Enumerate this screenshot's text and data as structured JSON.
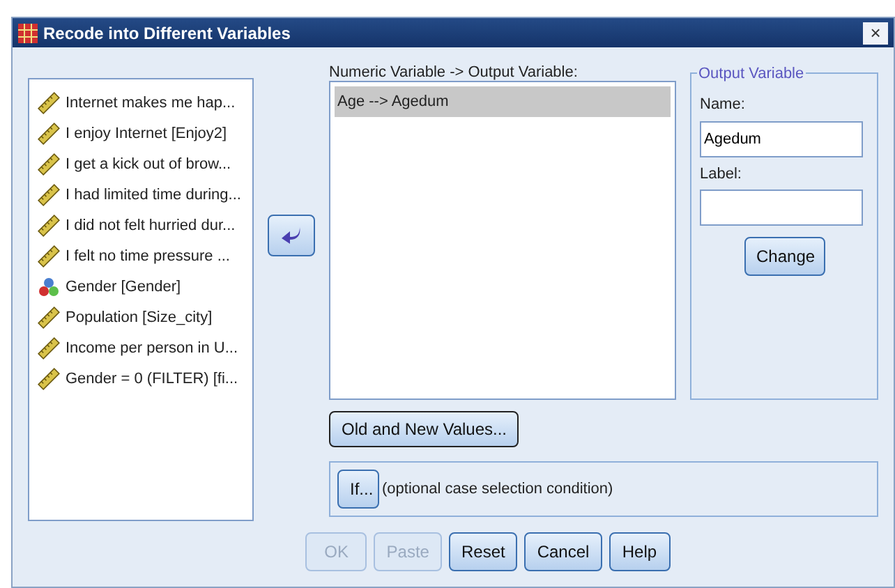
{
  "window": {
    "title": "Recode into Different Variables",
    "close": "×"
  },
  "variables": [
    {
      "label": "Internet makes me hap...",
      "kind": "scale",
      "selected": false
    },
    {
      "label": "I enjoy Internet [Enjoy2]",
      "kind": "scale",
      "selected": false
    },
    {
      "label": "I get a kick out of brow...",
      "kind": "scale",
      "selected": false
    },
    {
      "label": "I had limited time during...",
      "kind": "scale",
      "selected": false
    },
    {
      "label": "I did not felt hurried dur...",
      "kind": "scale",
      "selected": false
    },
    {
      "label": "I felt no time pressure ...",
      "kind": "scale",
      "selected": false
    },
    {
      "label": "Gender [Gender]",
      "kind": "nominal",
      "selected": false
    },
    {
      "label": "Population [Size_city]",
      "kind": "scale",
      "selected": false
    },
    {
      "label": "Income per person in U...",
      "kind": "scale",
      "selected": false
    },
    {
      "label": "Gender = 0 (FILTER) [fi...",
      "kind": "scale",
      "selected": false
    }
  ],
  "mapping": {
    "label": "Numeric Variable -> Output Variable:",
    "items": [
      {
        "label": "Age --> Agedum",
        "selected": true
      }
    ]
  },
  "output_variable": {
    "title": "Output Variable",
    "name_label": "Name:",
    "name_value": "Agedum",
    "label_label": "Label:",
    "change_button": "Change"
  },
  "old_new_button": "Old and New Values...",
  "if_button": "If...",
  "if_note": "(optional case selection condition)",
  "buttons": [
    {
      "label": "OK",
      "disabled": true
    },
    {
      "label": "Paste",
      "disabled": true
    },
    {
      "label": "Reset",
      "disabled": false
    },
    {
      "label": "Cancel",
      "disabled": false
    },
    {
      "label": "Help",
      "disabled": false
    }
  ]
}
